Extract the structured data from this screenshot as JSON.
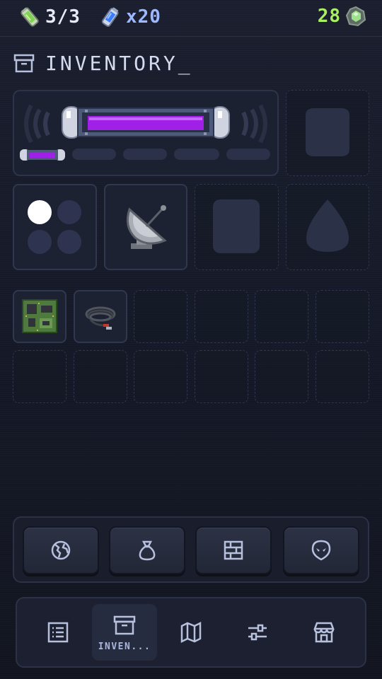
{
  "status": {
    "energy": "3/3",
    "energy_icon": "energy-cell-icon",
    "boost": "x20",
    "boost_icon": "boost-canister-icon",
    "gems": "28",
    "gems_icon": "gem-icon"
  },
  "header": {
    "title": "INVENTORY_",
    "icon": "archive-box-icon"
  },
  "equipment": {
    "capsule": {
      "icon": "plasma-capsule-icon",
      "color": "#a020e8",
      "segments": 4
    },
    "slot_2": {
      "icon": "armor-silhouette-icon",
      "empty": true
    },
    "slot_dots": {
      "icon": "four-dot-pad-icon",
      "lit": 1,
      "total": 4
    },
    "slot_dish": {
      "icon": "satellite-dish-icon"
    },
    "slot_5": {
      "icon": "tablet-silhouette-icon",
      "empty": true
    },
    "slot_6": {
      "icon": "droplet-silhouette-icon",
      "empty": true
    }
  },
  "items": [
    {
      "icon": "circuit-board-icon"
    },
    {
      "icon": "cable-coil-icon"
    }
  ],
  "empty_slots": 10,
  "actions": [
    {
      "icon": "globe-icon"
    },
    {
      "icon": "sack-icon"
    },
    {
      "icon": "grid-icon"
    },
    {
      "icon": "alien-icon"
    }
  ],
  "nav": [
    {
      "icon": "list-icon",
      "label": ""
    },
    {
      "icon": "archive-box-icon",
      "label": "INVEN...",
      "active": true
    },
    {
      "icon": "map-icon",
      "label": ""
    },
    {
      "icon": "sliders-icon",
      "label": ""
    },
    {
      "icon": "shop-icon",
      "label": ""
    }
  ],
  "colors": {
    "accent_green": "#a9ef63",
    "accent_blue": "#9db8ff",
    "capsule_purple": "#a020e8",
    "panel_bg": "#1c2132"
  }
}
